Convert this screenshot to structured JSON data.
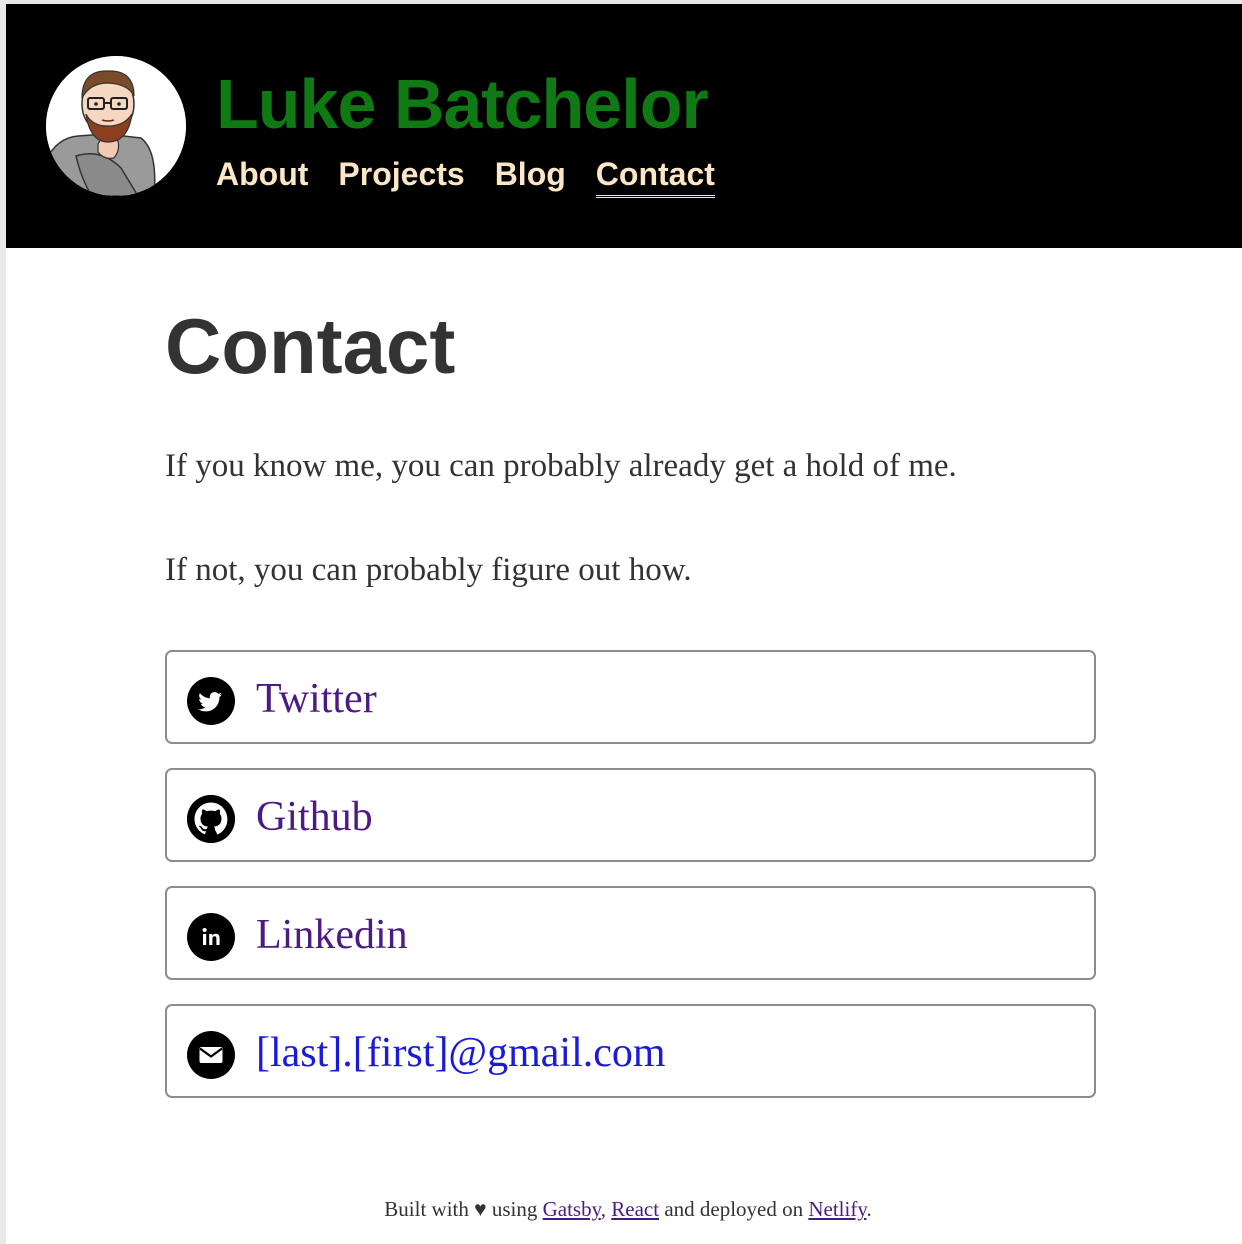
{
  "header": {
    "site_title": "Luke Batchelor",
    "avatar_alt": "Luke Batchelor avatar illustration",
    "title_color": "#0f7a14",
    "nav": [
      {
        "label": "About",
        "active": false
      },
      {
        "label": "Projects",
        "active": false
      },
      {
        "label": "Blog",
        "active": false
      },
      {
        "label": "Contact",
        "active": true
      }
    ],
    "nav_color": "#fde6c6"
  },
  "main": {
    "title": "Contact",
    "paragraphs": [
      "If you know me, you can probably already get a hold of me.",
      "If not, you can probably figure out how."
    ],
    "contacts": [
      {
        "label": "Twitter",
        "icon": "twitter-icon",
        "color": "#4b1a83"
      },
      {
        "label": "Github",
        "icon": "github-icon",
        "color": "#4b1a83"
      },
      {
        "label": "Linkedin",
        "icon": "linkedin-icon",
        "color": "#4b1a83"
      },
      {
        "label": "[last].[first]@gmail.com",
        "icon": "email-icon",
        "color": "#1a1adb"
      }
    ]
  },
  "footer": {
    "prefix": "Built with",
    "heart": "♥",
    "using": "using",
    "links": [
      "Gatsby",
      "React",
      "Netlify"
    ],
    "comma": ",",
    "and_deployed": "and deployed on",
    "period": "."
  }
}
